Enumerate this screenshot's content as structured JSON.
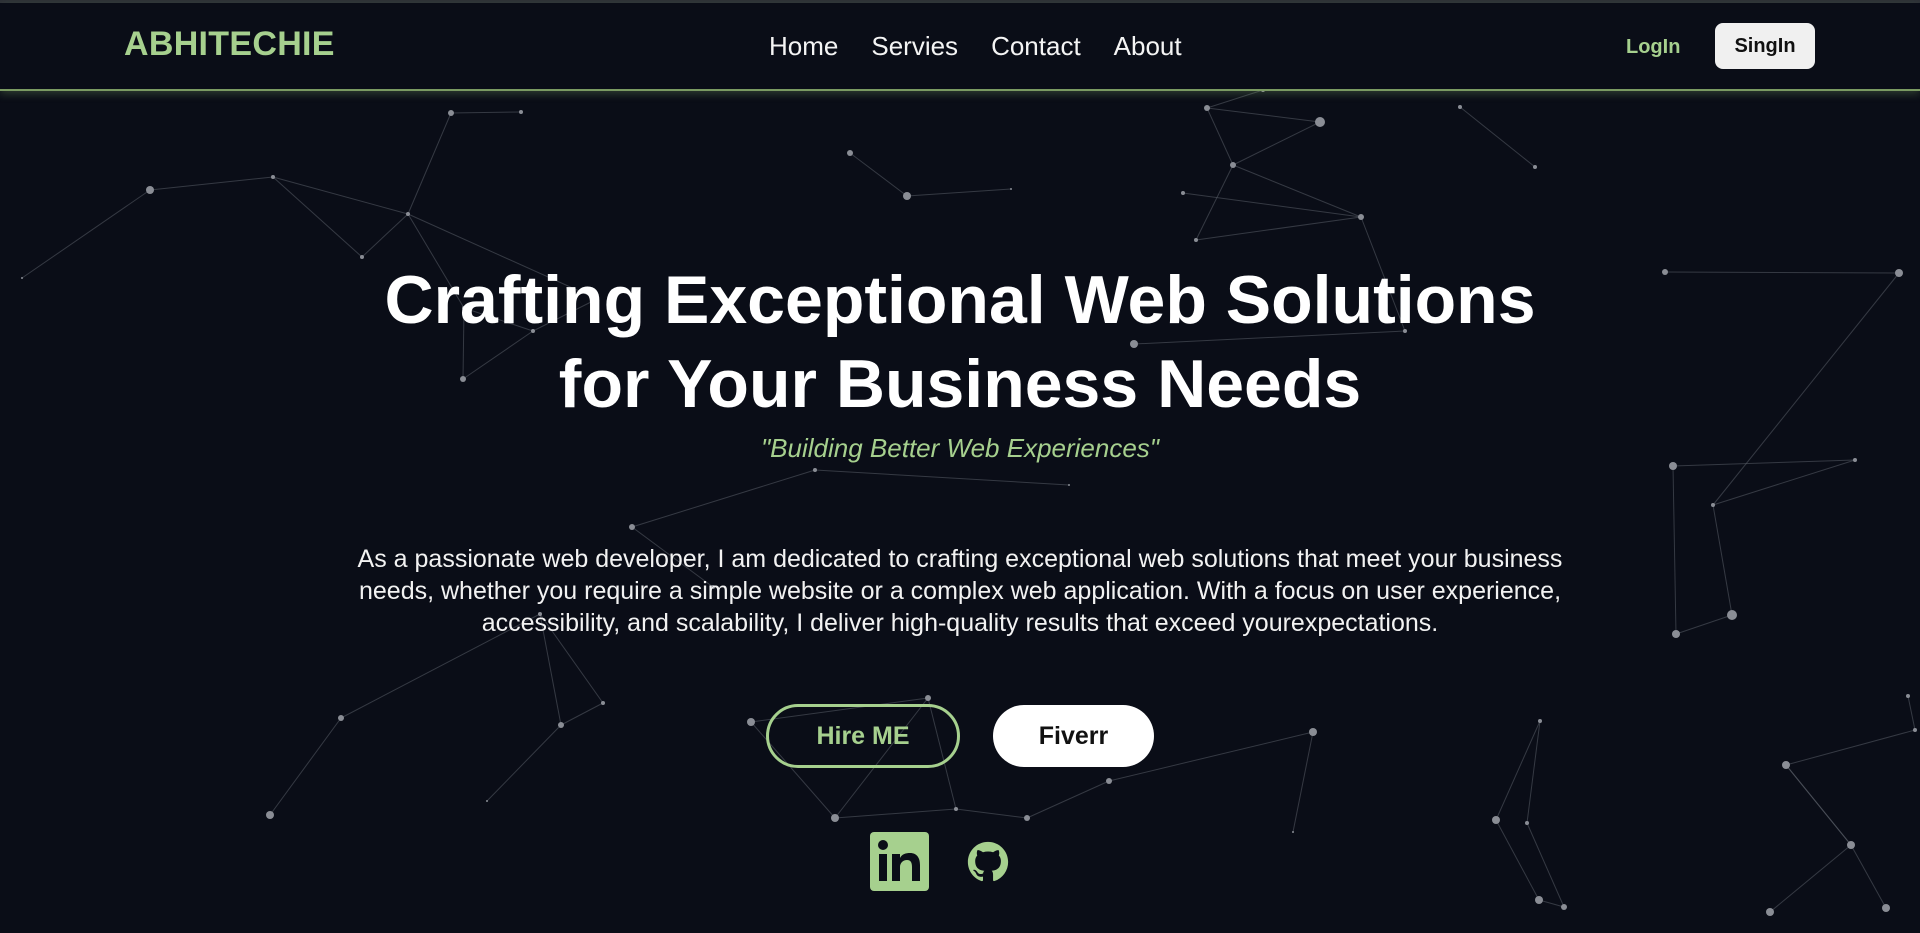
{
  "navbar": {
    "logo": "ABHITECHIE",
    "links": [
      "Home",
      "Servies",
      "Contact",
      "About"
    ],
    "login_label": "LogIn",
    "signin_label": "SingIn"
  },
  "hero": {
    "headline_line1": "Crafting Exceptional Web Solutions",
    "headline_line2": "for Your Business Needs",
    "tagline": "\"Building Better Web Experiences\"",
    "description": "As a passionate web developer, I am dedicated to crafting exceptional web solutions that meet your business needs, whether you require a simple website or a complex web application. With a focus on user experience, accessibility, and scalability, I deliver high-quality results that exceed yourexpectations.",
    "hire_label": "Hire ME",
    "fiverr_label": "Fiverr"
  },
  "social": {
    "icons": [
      "linkedin-icon",
      "github-icon"
    ]
  },
  "colors": {
    "background": "#0a0d17",
    "accent": "#a6d08e",
    "text": "#ffffff"
  }
}
